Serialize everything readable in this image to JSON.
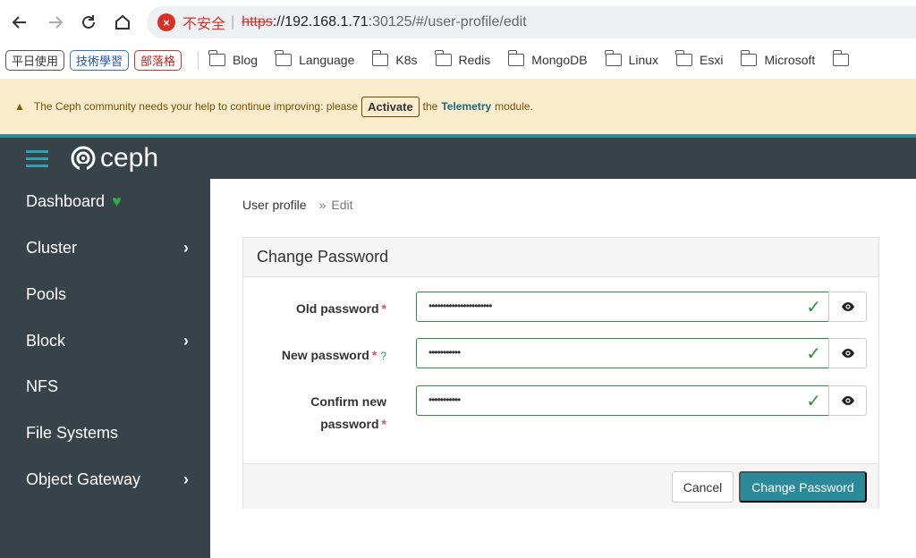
{
  "browser": {
    "insecure_label": "不安全",
    "url_scheme": "https",
    "url_host": "://192.168.1.71",
    "url_path": ":30125/#/user-profile/edit"
  },
  "bookmarks": {
    "tags": [
      "平日使用",
      "技術學習",
      "部落格"
    ],
    "folders": [
      "Blog",
      "Language",
      "K8s",
      "Redis",
      "MongoDB",
      "Linux",
      "Esxi",
      "Microsoft"
    ]
  },
  "banner": {
    "text_before": "The Ceph community needs your help to continue improving: please",
    "activate_label": "Activate",
    "text_the": "the",
    "telemetry_label": "Telemetry",
    "text_after": "module."
  },
  "app": {
    "logo_text": "ceph"
  },
  "sidebar": {
    "items": [
      {
        "label": "Dashboard"
      },
      {
        "label": "Cluster"
      },
      {
        "label": "Pools"
      },
      {
        "label": "Block"
      },
      {
        "label": "NFS"
      },
      {
        "label": "File Systems"
      },
      {
        "label": "Object Gateway"
      }
    ]
  },
  "breadcrumb": {
    "parent": "User profile",
    "separator": "»",
    "current": "Edit"
  },
  "form": {
    "title": "Change Password",
    "old_password": {
      "label": "Old password",
      "required": "*",
      "masked_value": "••••••••••••••••••••••"
    },
    "new_password": {
      "label": "New password",
      "required": "*",
      "help": "?",
      "masked_value": "•••••••••••"
    },
    "confirm_password": {
      "label_line1": "Confirm new",
      "label_line2": "password",
      "required": "*",
      "masked_value": "•••••••••••"
    },
    "cancel_label": "Cancel",
    "submit_label": "Change Password"
  }
}
